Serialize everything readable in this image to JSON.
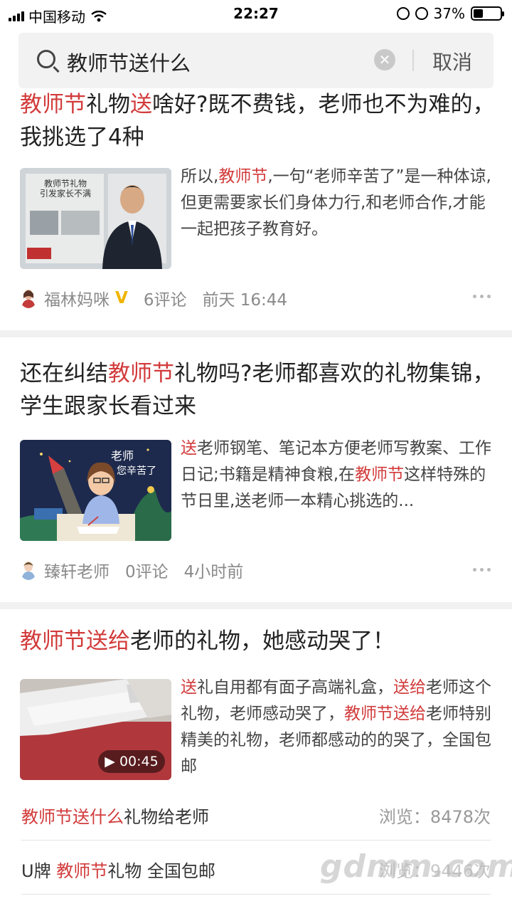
{
  "status": {
    "carrier": "中国移动",
    "time": "22:27",
    "battery": "37%",
    "battery_level": 0.37
  },
  "search": {
    "query": "教师节送什么",
    "cancel_label": "取消"
  },
  "articles": [
    {
      "title_parts": [
        {
          "t": "教师节",
          "hl": true
        },
        {
          "t": "礼物",
          "hl": false
        },
        {
          "t": "送",
          "hl": true
        },
        {
          "t": "啥好?既不费钱，老师也不为难的，我挑选了4种",
          "hl": false
        }
      ],
      "excerpt_parts": [
        {
          "t": "所以,",
          "hl": false
        },
        {
          "t": "教师节",
          "hl": true
        },
        {
          "t": ",一句“老师辛苦了”是一种体谅,但更需要家长们身体力行,和老师合作,才能一起把孩子教育好。",
          "hl": false
        }
      ],
      "author": "福林妈咪",
      "verified_mark": "V",
      "comments": "6评论",
      "time": "前天 16:44"
    },
    {
      "title_parts": [
        {
          "t": "还在纠结",
          "hl": false
        },
        {
          "t": "教师节",
          "hl": true
        },
        {
          "t": "礼物吗?老师都喜欢的礼物集锦，学生跟家长看过来",
          "hl": false
        }
      ],
      "excerpt_parts": [
        {
          "t": "送",
          "hl": true
        },
        {
          "t": "老师钢笔、笔记本方便老师写教案、工作日记;书籍是精神食粮,在",
          "hl": false
        },
        {
          "t": "教师节",
          "hl": true
        },
        {
          "t": "这样特殊的节日里,送老师一本精心挑选的...",
          "hl": false
        }
      ],
      "author": "臻轩老师",
      "comments": "0评论",
      "time": "4小时前"
    },
    {
      "title_parts": [
        {
          "t": "教师节送给",
          "hl": true
        },
        {
          "t": "老师的礼物，她感动哭了！",
          "hl": false
        }
      ],
      "excerpt_parts": [
        {
          "t": "送",
          "hl": true
        },
        {
          "t": "礼自用都有面子高端礼盒，",
          "hl": false
        },
        {
          "t": "送给",
          "hl": true
        },
        {
          "t": "老师这个礼物，老师感动哭了，",
          "hl": false
        },
        {
          "t": "教师节送给",
          "hl": true
        },
        {
          "t": "老师特别精美的礼物，老师都感动的的哭了，全国包邮",
          "hl": false
        }
      ],
      "video_duration": "00:45"
    }
  ],
  "related": [
    {
      "parts": [
        {
          "t": "教师节送什么",
          "hl": true
        },
        {
          "t": "礼物给老师",
          "hl": false
        }
      ],
      "views": "浏览：8478次"
    },
    {
      "parts": [
        {
          "t": "U牌 ",
          "hl": false
        },
        {
          "t": "教师节",
          "hl": true
        },
        {
          "t": "礼物 全国包邮",
          "hl": false
        }
      ],
      "views": "浏览：9446次"
    }
  ],
  "thumb_text": {
    "a1_line1": "教师节礼物",
    "a1_line2": "引发家长不满",
    "a2_line1": "老师",
    "a2_line2": "您辛苦了"
  },
  "watermark": "gdmm.com"
}
